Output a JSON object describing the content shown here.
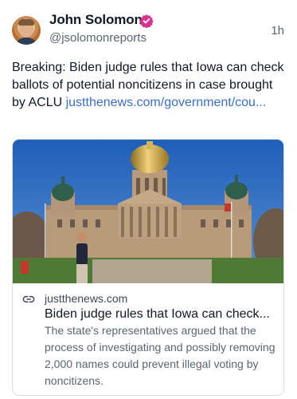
{
  "author": {
    "display_name": "John Solomon",
    "handle": "@jsolomonreports",
    "verified_icon": "verified-badge-icon",
    "badge_color": "#d7338f"
  },
  "post": {
    "time": "1h",
    "text": "Breaking: Biden judge rules that Iowa can check ballots of potential noncitizens in case brought by ACLU ",
    "link_text": "justthenews.com/government/cou..."
  },
  "card": {
    "domain": "justthenews.com",
    "title": "Biden judge rules that Iowa can check...",
    "description": "The state's representatives argued that the process of investigating and possibly removing 2,000 names could prevent illegal voting by noncitizens.",
    "link_icon": "link-icon"
  },
  "colors": {
    "link": "#3a6fc9",
    "muted": "#5b6472",
    "border": "#d9dde3"
  }
}
